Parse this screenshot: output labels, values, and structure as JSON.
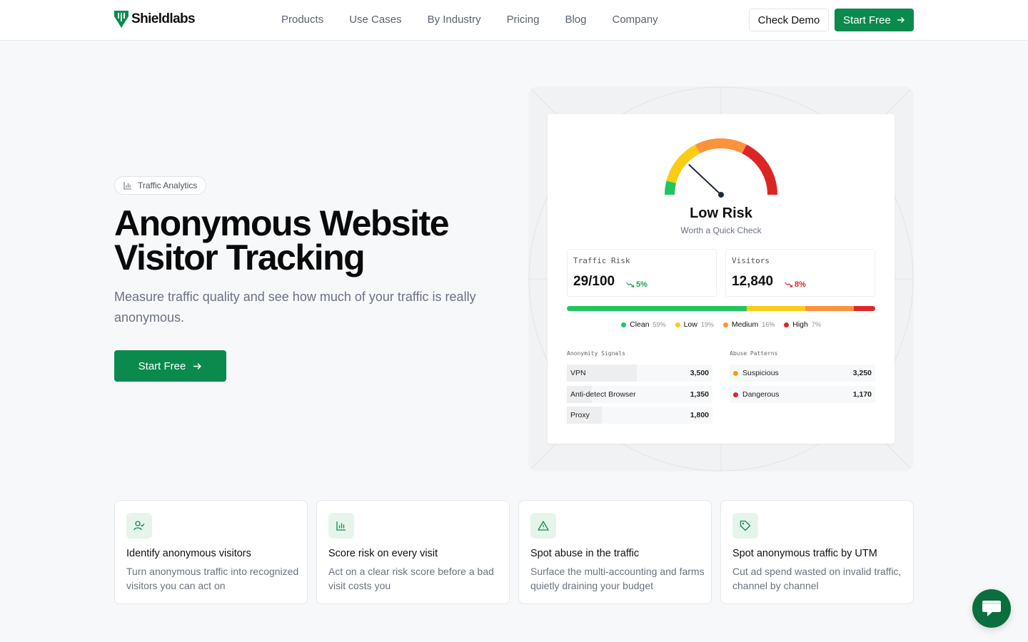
{
  "brand": {
    "name": "Shieldlabs"
  },
  "nav": {
    "items": [
      "Products",
      "Use Cases",
      "By Industry",
      "Pricing",
      "Blog",
      "Company"
    ]
  },
  "header": {
    "demo_label": "Check Demo",
    "start_label": "Start Free"
  },
  "hero": {
    "badge": "Traffic Analytics",
    "title": "Anonymous Website Visitor Tracking",
    "subtitle": "Measure traffic quality and see how much of your traffic is really anonymous.",
    "cta": "Start Free"
  },
  "dashboard": {
    "risk_title": "Low Risk",
    "risk_subtitle": "Worth a Quick Check",
    "gauge_value": 0.24,
    "stats": [
      {
        "label": "Traffic Risk",
        "value": "29/100",
        "delta": "5%",
        "trend": "down",
        "color": "#16a34a"
      },
      {
        "label": "Visitors",
        "value": "12,840",
        "delta": "8%",
        "trend": "down",
        "color": "#dc2626"
      }
    ],
    "breakdown": [
      {
        "name": "Clean",
        "pct": "59%",
        "share": 59,
        "color": "#22c55e"
      },
      {
        "name": "Low",
        "pct": "19%",
        "share": 19,
        "color": "#facc15"
      },
      {
        "name": "Medium",
        "pct": "16%",
        "share": 16,
        "color": "#fb923c"
      },
      {
        "name": "High",
        "pct": "7%",
        "share": 7,
        "color": "#dc2626"
      }
    ],
    "anonymity_label": "Anonymity Signals",
    "anonymity": [
      {
        "name": "VPN",
        "value": "3,500",
        "share": 0.48
      },
      {
        "name": "Anti-detect Browser",
        "value": "1,350",
        "share": 0.17
      },
      {
        "name": "Proxy",
        "value": "1,800",
        "share": 0.24
      }
    ],
    "abuse_label": "Abuse Patterns",
    "abuse": [
      {
        "name": "Suspicious",
        "value": "3,250",
        "color": "#f59e0b"
      },
      {
        "name": "Dangerous",
        "value": "1,170",
        "color": "#dc2626"
      }
    ]
  },
  "features": [
    {
      "icon": "user-check-icon",
      "title": "Identify anonymous visitors",
      "desc": "Turn anonymous traffic into recognized visitors you can act on"
    },
    {
      "icon": "bar-chart-icon",
      "title": "Score risk on every visit",
      "desc": "Act on a clear risk score before a bad visit costs you"
    },
    {
      "icon": "warning-icon",
      "title": "Spot abuse in the traffic",
      "desc": "Surface the multi-accounting and farms quietly draining your budget"
    },
    {
      "icon": "tag-icon",
      "title": "Spot anonymous traffic by UTM",
      "desc": "Cut ad spend wasted on invalid traffic, channel by channel"
    }
  ],
  "colors": {
    "brand": "#0b8a4e",
    "chat": "#0b6e3f"
  }
}
